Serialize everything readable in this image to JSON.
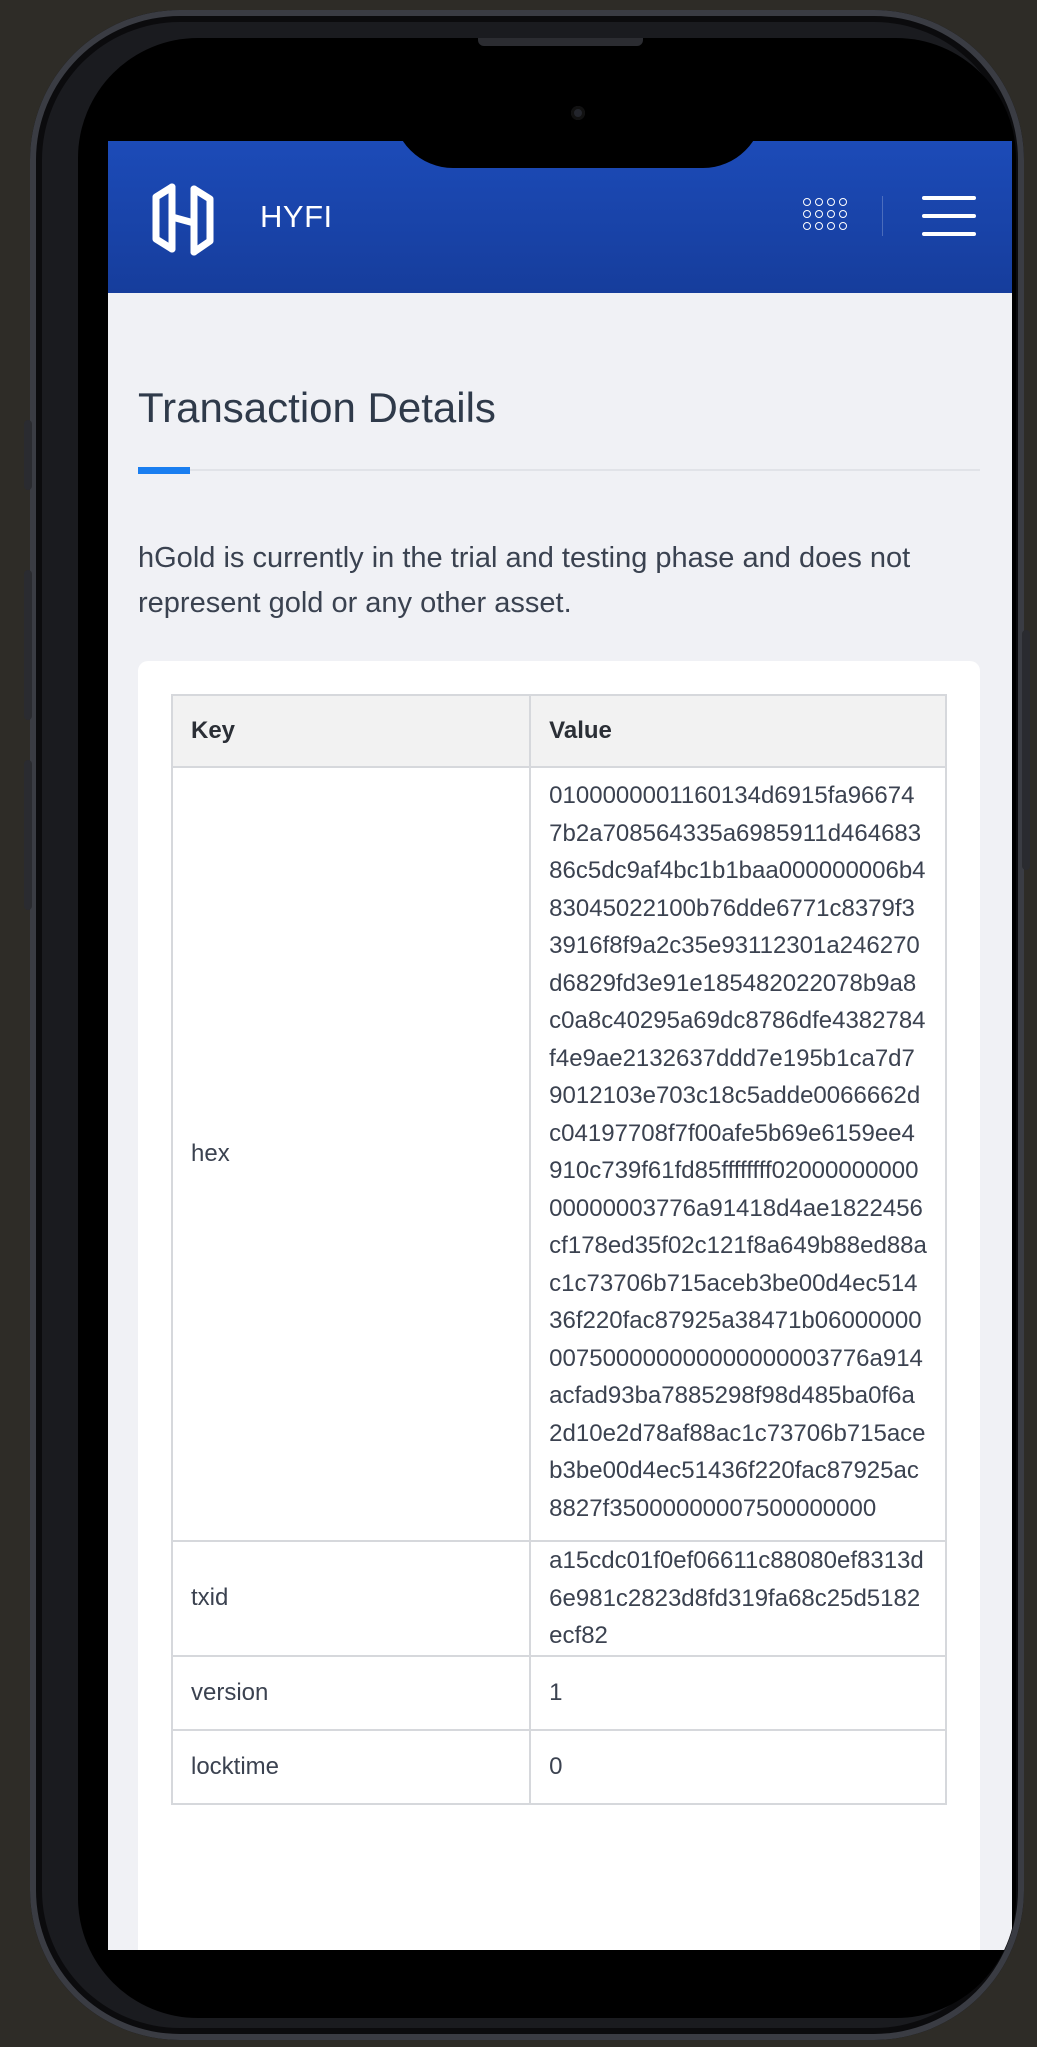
{
  "app": {
    "brand": "HYFI"
  },
  "header": {
    "logo_icon": "hyfi-logo-icon",
    "apps_icon": "grid-apps-icon",
    "menu_icon": "hamburger-menu-icon"
  },
  "page": {
    "title": "Transaction Details",
    "notice": "hGold is currently in the trial and testing phase and does not represent gold or any other asset."
  },
  "table": {
    "headers": {
      "key": "Key",
      "value": "Value"
    },
    "rows": [
      {
        "key": "hex",
        "value": "0100000001160134d6915fa966747b2a708564335a6985911d46468386c5dc9af4bc1b1baa000000006b483045022100b76dde6771c8379f33916f8f9a2c35e93112301a246270d6829fd3e91e185482022078b9a8c0a8c40295a69dc8786dfe4382784f4e9ae2132637ddd7e195b1ca7d79012103e703c18c5adde0066662dc04197708f7f00afe5b69e6159ee4910c739f61fd85ffffffff0200000000000000003776a91418d4ae1822456cf178ed35f02c121f8a649b88ed88ac1c73706b715aceb3be00d4ec51436f220fac87925a38471b06000000007500000000000000003776a914acfad93ba7885298f98d485ba0f6a2d10e2d78af88ac1c73706b715aceb3be00d4ec51436f220fac87925ac8827f35000000007500000000"
      },
      {
        "key": "txid",
        "value": "a15cdc01f0ef06611c88080ef8313d6e981c2823d8fd319fa68c25d5182ecf82"
      },
      {
        "key": "version",
        "value": "1"
      },
      {
        "key": "locktime",
        "value": "0"
      }
    ]
  }
}
